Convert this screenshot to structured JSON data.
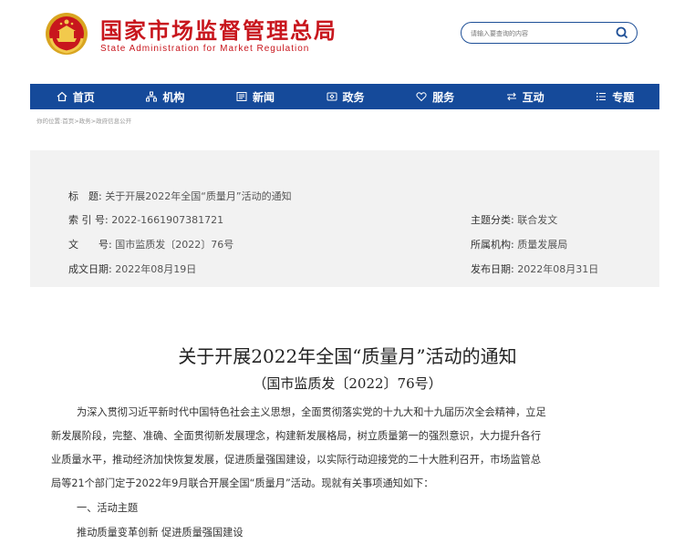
{
  "header": {
    "title": "国家市场监督管理总局",
    "subtitle": "State Administration for Market Regulation",
    "search_placeholder": "请输入要查询的内容",
    "emblem_icon": "national-emblem-icon",
    "brand_color": "#c8161d"
  },
  "nav": {
    "bg_color": "#154a9a",
    "items": [
      {
        "label": "首页",
        "icon": "home-icon"
      },
      {
        "label": "机构",
        "icon": "org-icon"
      },
      {
        "label": "新闻",
        "icon": "news-icon"
      },
      {
        "label": "政务",
        "icon": "gov-icon"
      },
      {
        "label": "服务",
        "icon": "heart-icon"
      },
      {
        "label": "互动",
        "icon": "exchange-icon"
      },
      {
        "label": "专题",
        "icon": "topic-icon"
      }
    ]
  },
  "breadcrumb": {
    "prefix": "你的位置:",
    "items": [
      "首页",
      "政务",
      "政府信息公开"
    ],
    "separator": ">"
  },
  "info": {
    "title_label": "标　题:",
    "title_value": "关于开展2022年全国“质量月”活动的通知",
    "index_label": "索 引 号:",
    "index_value": "2022-1661907381721",
    "docno_label": "文　　号:",
    "docno_value": "国市监质发〔2022〕76号",
    "created_label": "成文日期:",
    "created_value": "2022年08月19日",
    "category_label": "主题分类:",
    "category_value": "联合发文",
    "org_label": "所属机构:",
    "org_value": "质量发展局",
    "published_label": "发布日期:",
    "published_value": "2022年08月31日"
  },
  "article": {
    "title": "关于开展2022年全国“质量月”活动的通知",
    "docno": "（国市监质发〔2022〕76号）",
    "para_lines": [
      "为深入贯彻习近平新时代中国特色社会主义思想，全面贯彻落实党的十九大和十九届历次全会精神，立足",
      "新发展阶段，完整、准确、全面贯彻新发展理念，构建新发展格局，树立质量第一的强烈意识，大力提升各行",
      "业质量水平，推动经济加快恢复发展，促进质量强国建设，以实际行动迎接党的二十大胜利召开，市场监管总",
      "局等21个部门定于2022年9月联合开展全国“质量月”活动。现就有关事项通知如下："
    ],
    "section1_heading": "一、活动主题",
    "section1_text": "推动质量变革创新 促进质量强国建设"
  }
}
